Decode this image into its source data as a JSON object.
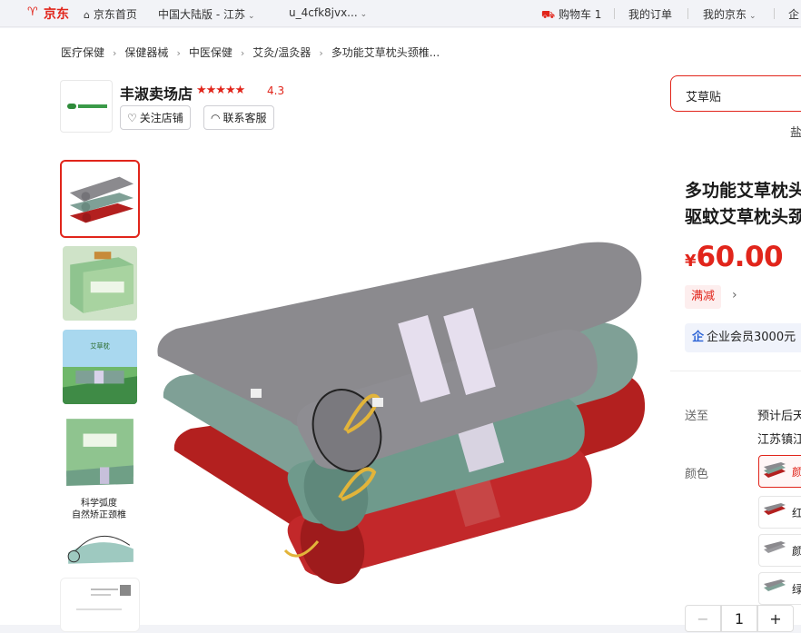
{
  "topbar": {
    "logo": "京东",
    "home": "京东首页",
    "region": "中国大陆版 - 江苏",
    "user": "u_4cfk8jvx...",
    "cart": "购物车 1",
    "orders": "我的订单",
    "myjd": "我的京东",
    "more": "企"
  },
  "breadcrumb": [
    "医疗保健",
    "保健器械",
    "中医保健",
    "艾灸/温灸器",
    "多功能艾草枕头颈椎..."
  ],
  "shop": {
    "name": "丰淑卖场店",
    "stars": "★★★★★",
    "rating": "4.3",
    "follow": "关注店铺",
    "service": "联系客服"
  },
  "search": {
    "value": "艾草贴",
    "hot": "盐"
  },
  "thumbnails": [
    {
      "name": "pillow-stack"
    },
    {
      "name": "gift-box"
    },
    {
      "name": "scenery"
    },
    {
      "name": "green-box"
    },
    {
      "name": "neck-curve",
      "text_1": "科学弧度",
      "text_2": "自然矫正颈椎"
    },
    {
      "name": "document"
    }
  ],
  "product": {
    "title_line1": "多功能艾草枕头",
    "title_line2": "驱蚊艾草枕头颈",
    "currency": "¥",
    "price": "60.00",
    "promo": "满减",
    "member": "企业会员3000元",
    "deliver_label": "送至",
    "deliver_line1": "预计后天",
    "deliver_line2": "江苏镇江",
    "color_label": "颜色",
    "colors": [
      "颜",
      "红",
      "颜",
      "绿"
    ],
    "qty": "1"
  },
  "colors": {
    "accent": "#e1251b",
    "gray_pillow": "#8b8a8e",
    "green_pillow": "#7fa096",
    "red_pillow": "#b3201f"
  }
}
